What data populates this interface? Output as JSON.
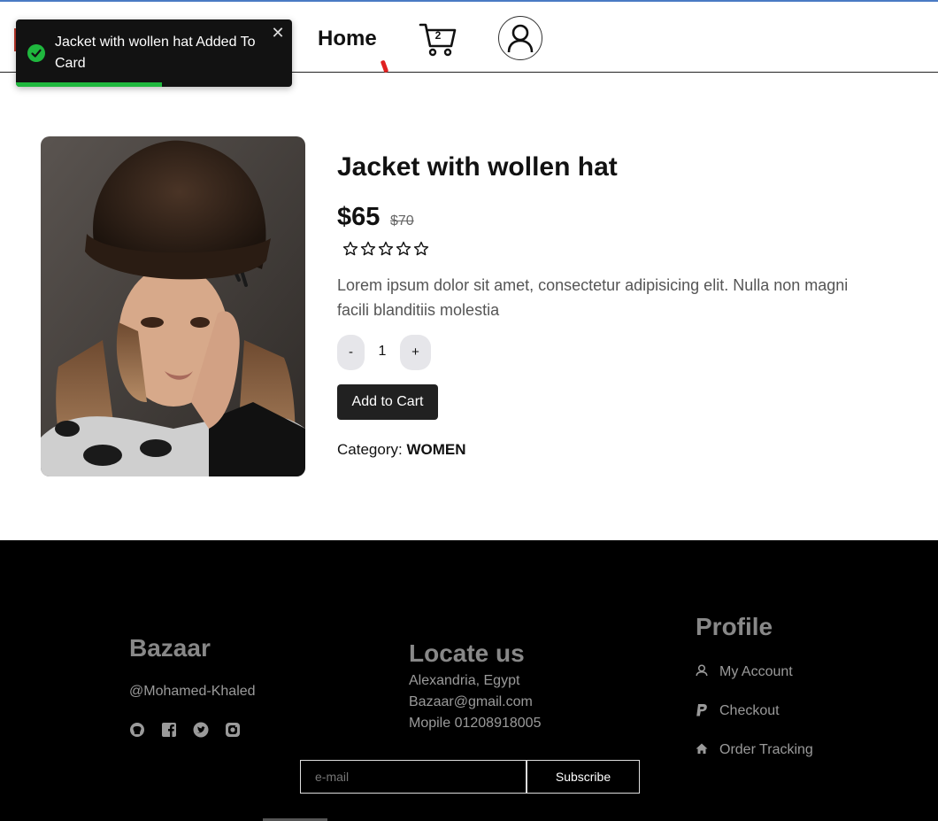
{
  "nav": {
    "home_label": "Home",
    "cart_count": "2"
  },
  "toast": {
    "message": "Jacket with wollen hat Added To Card",
    "close_symbol": "✕",
    "progress": 0.53,
    "accent_color": "#1fb83e"
  },
  "product": {
    "title": "Jacket with wollen hat",
    "price": "$65",
    "old_price": "$70",
    "rating_stars": 5,
    "rating_filled": 0,
    "description": "Lorem ipsum dolor sit amet, consectetur adipisicing elit. Nulla non magni facili blanditiis molestia",
    "qty_minus": "-",
    "quantity": "1",
    "qty_plus": "+",
    "add_to_cart": "Add to Cart",
    "category_label": "Category:",
    "category_value": "WOMEN"
  },
  "footer": {
    "brand": "Bazaar",
    "handle": "@Mohamed-Khaled",
    "social_icons": [
      "github-icon",
      "facebook-icon",
      "twitter-icon",
      "instagram-icon"
    ],
    "locate_title": "Locate us",
    "locate_lines": [
      "Alexandria, Egypt",
      "Bazaar@gmail.com",
      "Mopile 01208918005"
    ],
    "profile_title": "Profile",
    "profile_links": [
      {
        "icon": "user-icon",
        "label": "My Account"
      },
      {
        "icon": "paypal-icon",
        "label": "Checkout"
      },
      {
        "icon": "home-icon",
        "label": "Order Tracking"
      }
    ],
    "email_placeholder": "e-mail",
    "subscribe_label": "Subscribe"
  }
}
